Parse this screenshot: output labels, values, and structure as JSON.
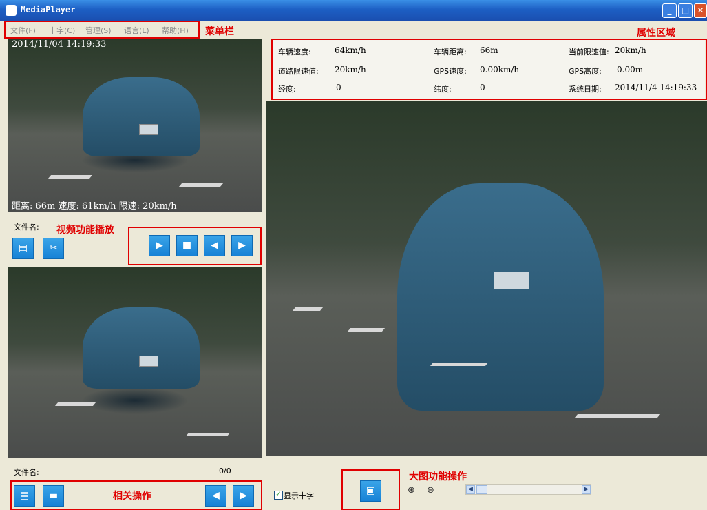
{
  "window": {
    "title": "MediaPlayer"
  },
  "menu": {
    "items": [
      "文件(F)",
      "十字(C)",
      "管理(S)",
      "语言(L)",
      "帮助(H)"
    ],
    "annotation": "菜单栏"
  },
  "properties": {
    "annotation": "属性区域",
    "rows": [
      [
        {
          "label": "车辆速度:",
          "value": "64km/h"
        },
        {
          "label": "车辆距离:",
          "value": "66m"
        },
        {
          "label": "当前限速值:",
          "value": "20km/h"
        }
      ],
      [
        {
          "label": "道路限速值:",
          "value": "20km/h"
        },
        {
          "label": "GPS速度:",
          "value": "0.00km/h"
        },
        {
          "label": "GPS高度:",
          "value": "0.00m"
        }
      ],
      [
        {
          "label": "经度:",
          "value": "0"
        },
        {
          "label": "纬度:",
          "value": "0"
        },
        {
          "label": "系统日期:",
          "value": "2014/11/4 14:19:33"
        }
      ]
    ]
  },
  "top_video": {
    "timestamp": "2014/11/04 14:19:33",
    "overlay": "距离: 66m 速度: 61km/h 限速: 20km/h",
    "file_label": "文件名:",
    "annotation": "视频功能播放"
  },
  "bottom_image": {
    "file_label": "文件名:",
    "counter": "0/0",
    "annotation": "相关操作"
  },
  "crosshair": {
    "label": "显示十字",
    "checked": true
  },
  "big_image": {
    "annotation": "大图功能操作"
  },
  "icons": [
    "import-icon",
    "cut-icon",
    "play-icon",
    "stop-icon",
    "prev-frame-icon",
    "next-frame-icon",
    "open-file-icon",
    "folder-icon",
    "prev-icon",
    "next-icon",
    "save-icon",
    "zoom-in-icon",
    "zoom-out-icon"
  ]
}
